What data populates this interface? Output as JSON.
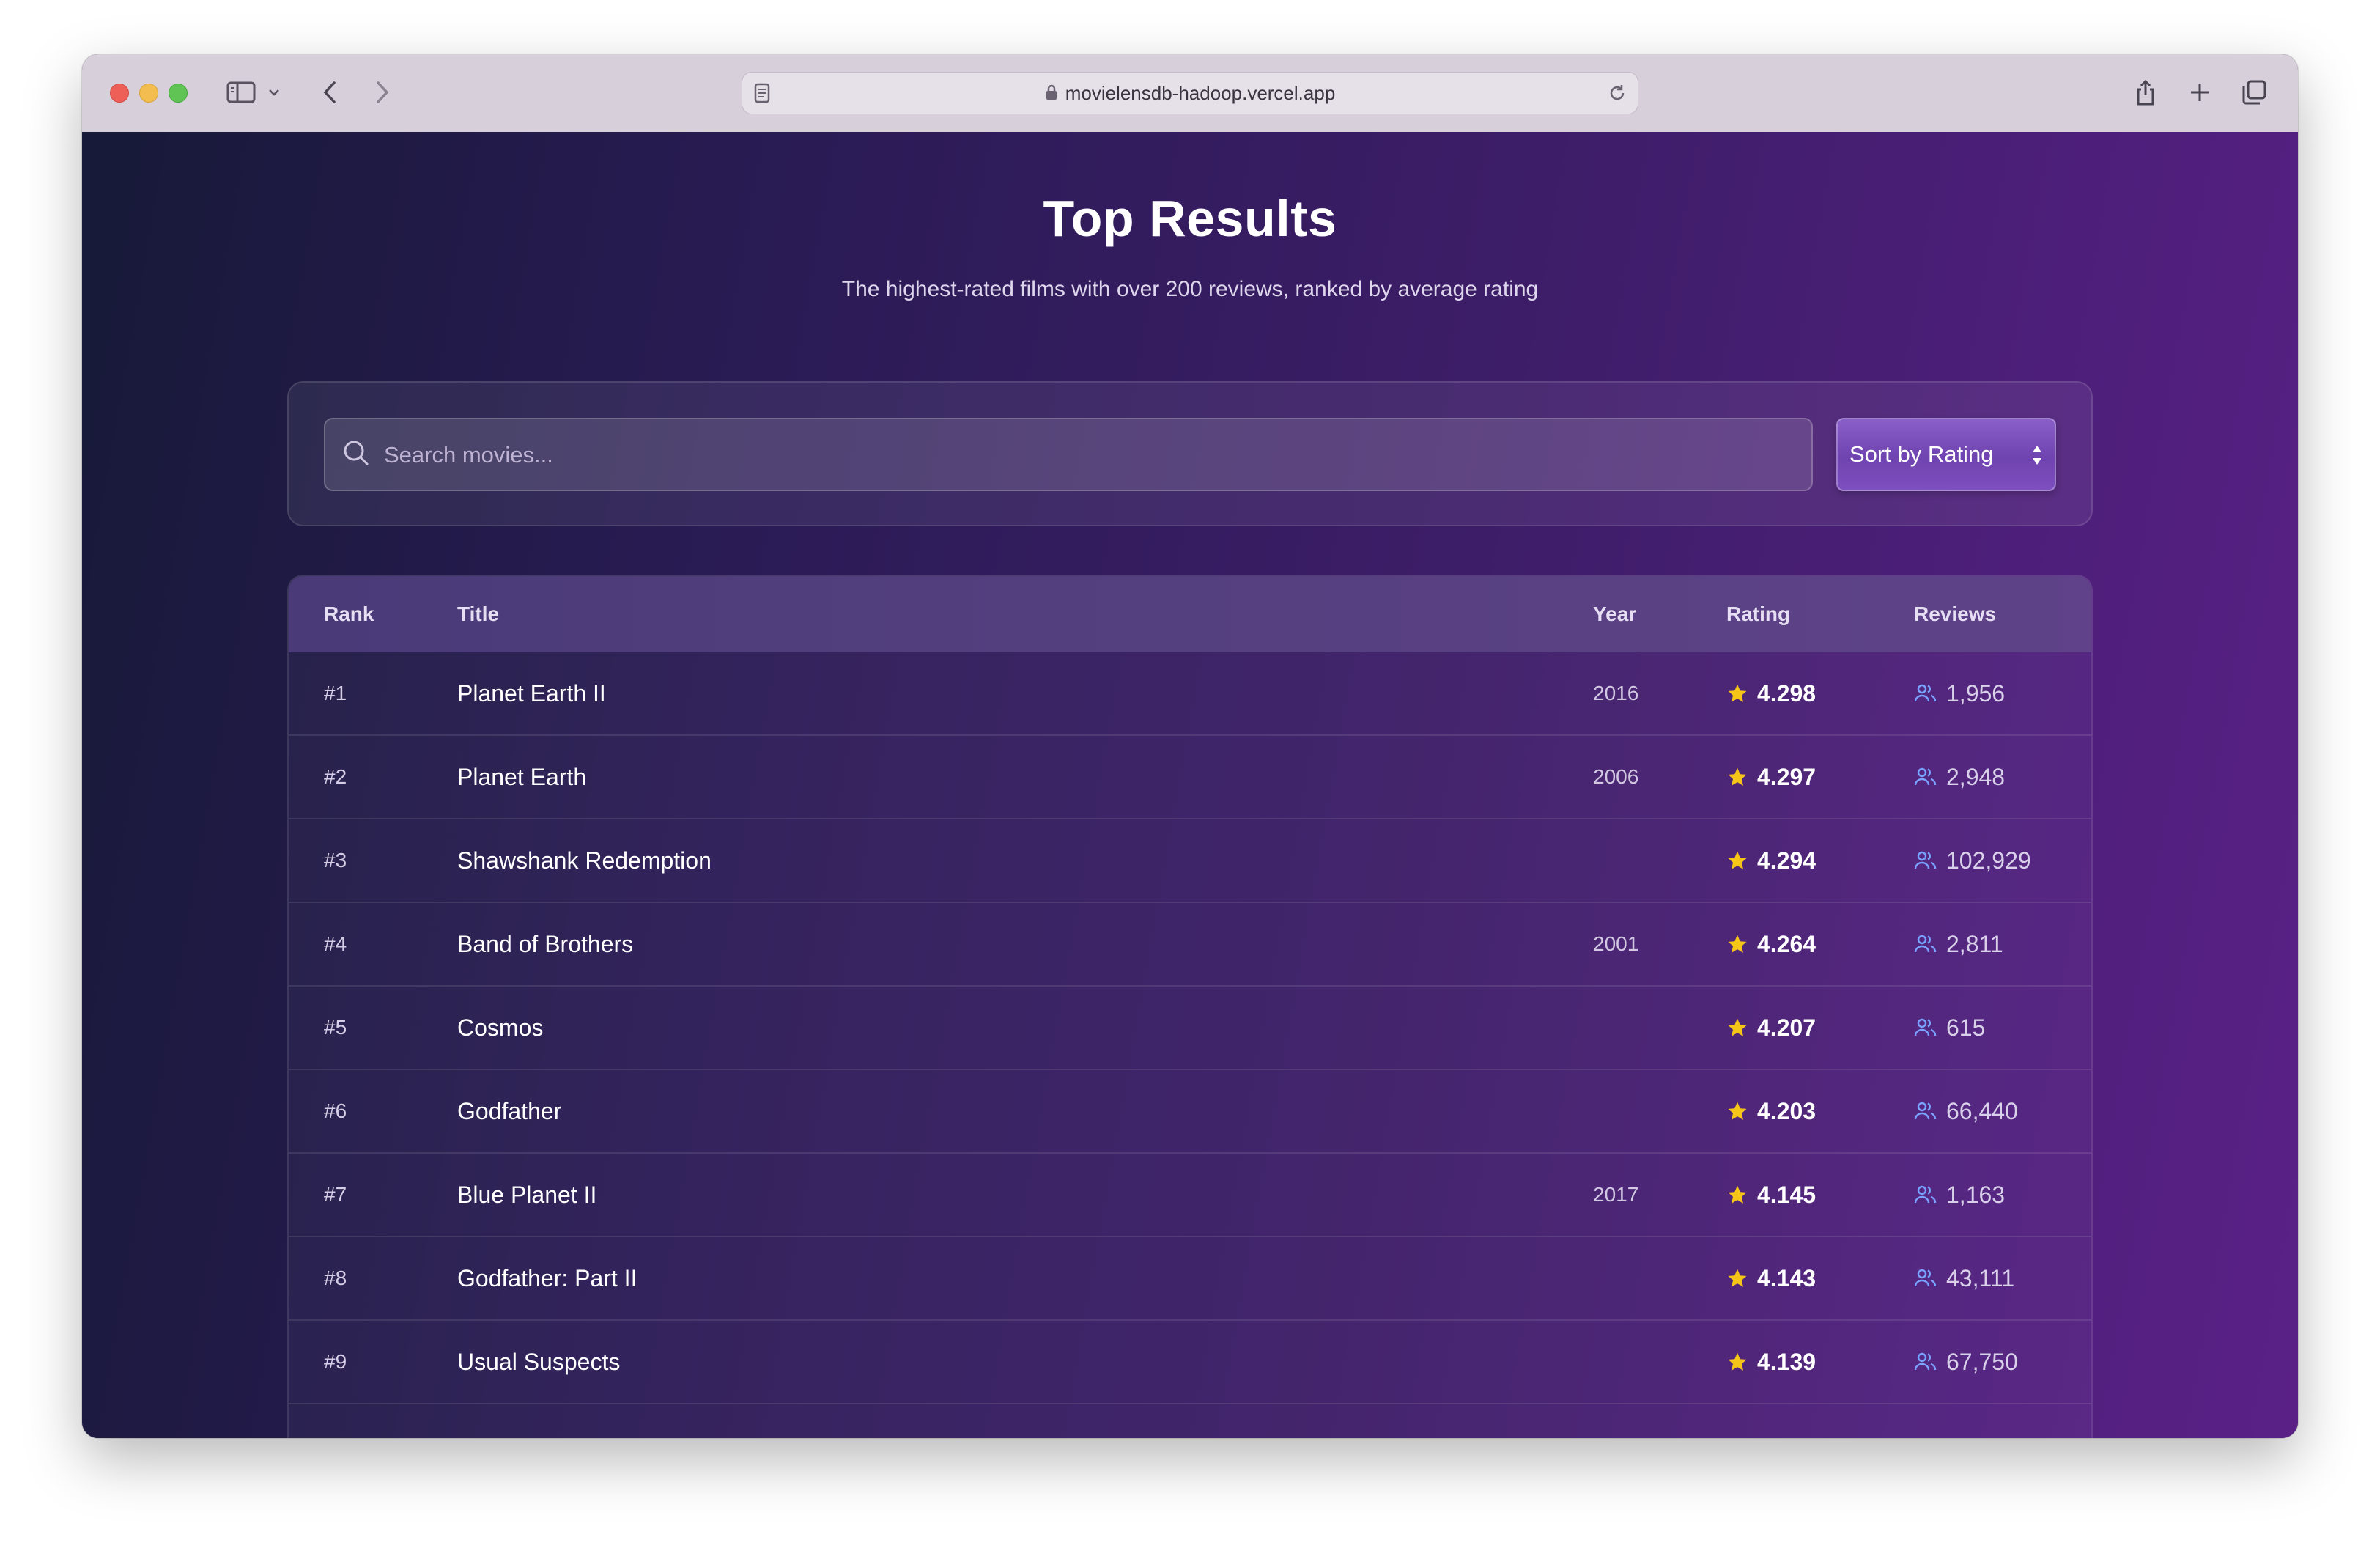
{
  "browser": {
    "url": "movielensdb-hadoop.vercel.app"
  },
  "header": {
    "title": "Top Results",
    "subtitle": "The highest-rated films with over 200 reviews, ranked by average rating"
  },
  "search": {
    "placeholder": "Search movies..."
  },
  "sort": {
    "selected": "Sort by Rating"
  },
  "table": {
    "columns": {
      "rank": "Rank",
      "title": "Title",
      "year": "Year",
      "rating": "Rating",
      "reviews": "Reviews"
    },
    "rows": [
      {
        "rank": "#1",
        "title": "Planet Earth II",
        "year": "2016",
        "rating": "4.298",
        "reviews": "1,956"
      },
      {
        "rank": "#2",
        "title": "Planet Earth",
        "year": "2006",
        "rating": "4.297",
        "reviews": "2,948"
      },
      {
        "rank": "#3",
        "title": "Shawshank Redemption",
        "year": "",
        "rating": "4.294",
        "reviews": "102,929"
      },
      {
        "rank": "#4",
        "title": "Band of Brothers",
        "year": "2001",
        "rating": "4.264",
        "reviews": "2,811"
      },
      {
        "rank": "#5",
        "title": "Cosmos",
        "year": "",
        "rating": "4.207",
        "reviews": "615"
      },
      {
        "rank": "#6",
        "title": "Godfather",
        "year": "",
        "rating": "4.203",
        "reviews": "66,440"
      },
      {
        "rank": "#7",
        "title": "Blue Planet II",
        "year": "2017",
        "rating": "4.145",
        "reviews": "1,163"
      },
      {
        "rank": "#8",
        "title": "Godfather: Part II",
        "year": "",
        "rating": "4.143",
        "reviews": "43,111"
      },
      {
        "rank": "#9",
        "title": "Usual Suspects",
        "year": "",
        "rating": "4.139",
        "reviews": "67,750"
      }
    ]
  },
  "colors": {
    "star": "#f5c518",
    "reviews_icon": "#7aa2ff",
    "accent": "#7d4fbf"
  }
}
